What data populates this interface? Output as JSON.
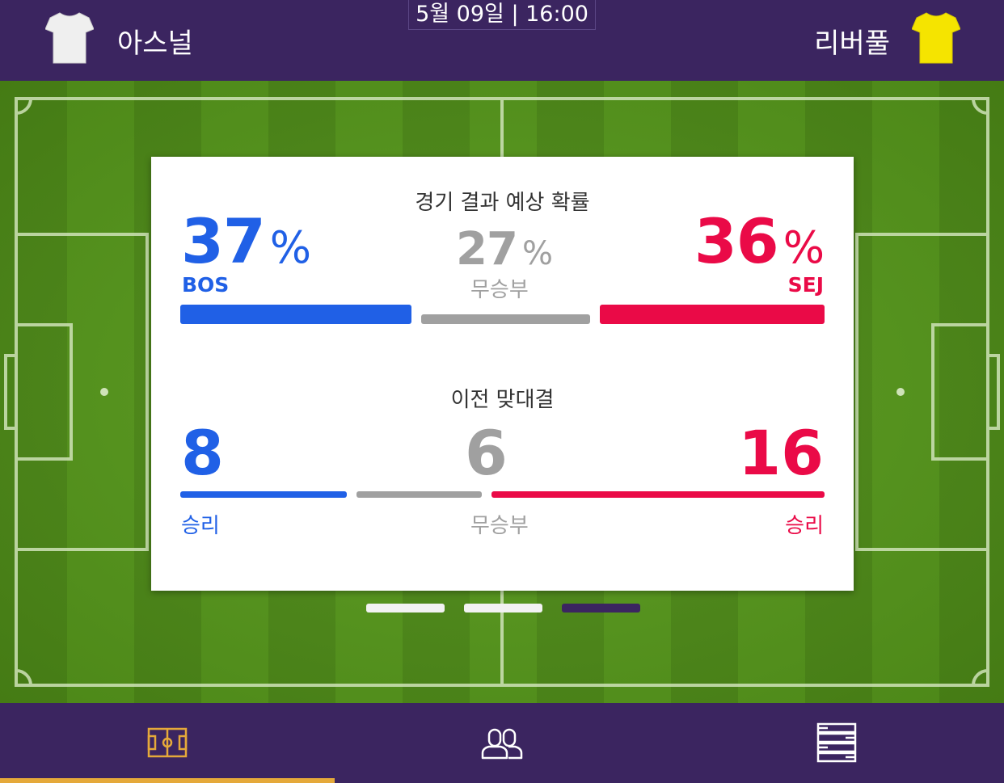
{
  "header": {
    "home_team": "아스널",
    "away_team": "리버풀",
    "datetime": "5월 09일 | 16:00",
    "home_shirt_color": "#f2f2f2",
    "away_shirt_color": "#f5e400"
  },
  "prediction": {
    "title": "경기 결과 예상 확률",
    "home": {
      "value": "37",
      "unit": "%",
      "code": "BOS",
      "percent": 37
    },
    "draw": {
      "value": "27",
      "unit": "%",
      "label": "무승부",
      "percent": 27
    },
    "away": {
      "value": "36",
      "unit": "%",
      "code": "SEJ",
      "percent": 36
    }
  },
  "head_to_head": {
    "title": "이전 맞대결",
    "home": {
      "value": "8",
      "label": "승리",
      "count": 8
    },
    "draw": {
      "value": "6",
      "label": "무승부",
      "count": 6
    },
    "away": {
      "value": "16",
      "label": "승리",
      "count": 16
    }
  },
  "pager": {
    "pages": 3,
    "active_index": 2
  },
  "nav": {
    "items": [
      {
        "icon": "field-icon",
        "active": true
      },
      {
        "icon": "players-icon",
        "active": false
      },
      {
        "icon": "list-icon",
        "active": false
      }
    ]
  },
  "colors": {
    "home": "#2060e6",
    "draw": "#a0a0a0",
    "away": "#ea0a47",
    "brand": "#3b2560",
    "accent": "#e5a93a"
  }
}
